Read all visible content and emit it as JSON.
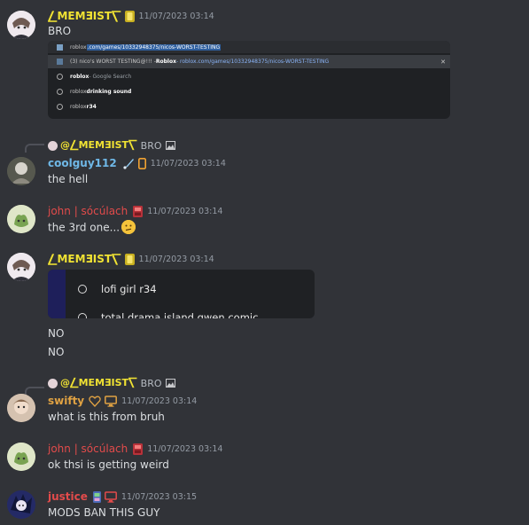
{
  "messages": [
    {
      "user": "⎳MEMƎIST⎲",
      "time": "11/07/2023 03:14",
      "text": "BRO"
    },
    {
      "reply_user": "@⎳MEMƎIST⎲",
      "reply_text": "BRO",
      "user": "coolguy112",
      "time": "11/07/2023 03:14",
      "text": "the hell"
    },
    {
      "user": "john | sócúlach",
      "time": "11/07/2023 03:14",
      "text": "the 3rd one..."
    },
    {
      "user": "⎳MEMƎIST⎲",
      "time": "11/07/2023 03:14",
      "text1": "NO",
      "text2": "NO"
    },
    {
      "reply_user": "@⎳MEMƎIST⎲",
      "reply_text": "BRO",
      "user": "swifty",
      "time": "11/07/2023 03:14",
      "text": "what is this from bruh"
    },
    {
      "user": "john | sócúlach",
      "time": "11/07/2023 03:14",
      "text": "ok thsi is getting weird"
    },
    {
      "user": "justice",
      "time": "11/07/2023 03:15",
      "text": "MODS BAN THIS GUY"
    }
  ],
  "browser_shot": {
    "address_prefix": "roblox",
    "address_selected": ".com/games/10332948375/nicos-WORST-TESTING",
    "suggestions": [
      {
        "prefix": "(3) nico's WORST TESTING@!!! - ",
        "bold": "Roblox",
        "url": " - roblox.com/games/10332948375/nicos-WORST-TESTING",
        "close": "✕"
      },
      {
        "bold": "roblox",
        "rest": " - Google Search"
      },
      {
        "plain": "roblox ",
        "bold": "drinking sound"
      },
      {
        "plain": "roblox ",
        "bold": "r34"
      }
    ]
  },
  "search_shot": {
    "items": [
      "lofi girl r34",
      "total drama island gwen comic"
    ]
  },
  "colors": {
    "background": "#313338",
    "memeist": "#f0e233",
    "coolguy": "#6fb8e7",
    "john": "#e24b4b",
    "swifty": "#e0a243",
    "justice": "#e24b4b"
  }
}
